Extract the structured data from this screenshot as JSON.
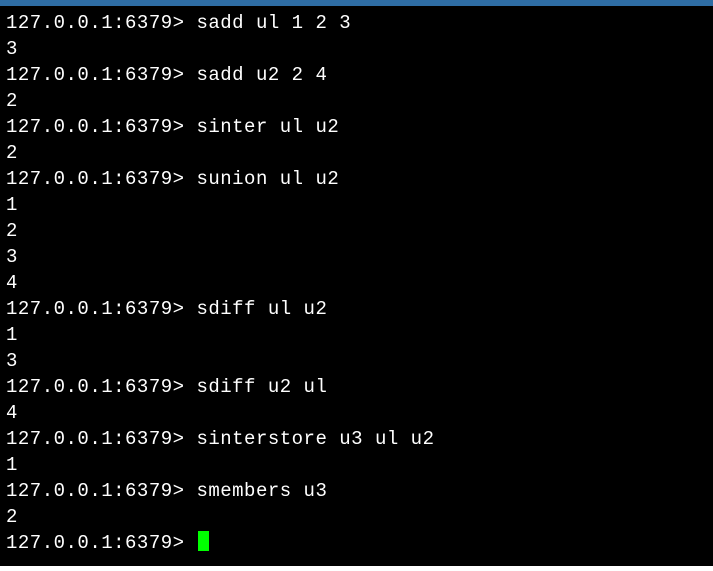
{
  "prompt": "127.0.0.1:6379>",
  "lines": [
    {
      "type": "cmd",
      "command": "sadd ul 1 2 3"
    },
    {
      "type": "out",
      "text": "3"
    },
    {
      "type": "cmd",
      "command": "sadd u2 2 4"
    },
    {
      "type": "out",
      "text": "2"
    },
    {
      "type": "cmd",
      "command": "sinter ul u2"
    },
    {
      "type": "out",
      "text": "2"
    },
    {
      "type": "cmd",
      "command": "sunion ul u2"
    },
    {
      "type": "out",
      "text": "1"
    },
    {
      "type": "out",
      "text": "2"
    },
    {
      "type": "out",
      "text": "3"
    },
    {
      "type": "out",
      "text": "4"
    },
    {
      "type": "cmd",
      "command": "sdiff ul u2"
    },
    {
      "type": "out",
      "text": "1"
    },
    {
      "type": "out",
      "text": "3"
    },
    {
      "type": "cmd",
      "command": "sdiff u2 ul"
    },
    {
      "type": "out",
      "text": "4"
    },
    {
      "type": "cmd",
      "command": "sinterstore u3 ul u2"
    },
    {
      "type": "out",
      "text": "1"
    },
    {
      "type": "cmd",
      "command": "smembers u3"
    },
    {
      "type": "out",
      "text": "2"
    },
    {
      "type": "cursor"
    }
  ]
}
